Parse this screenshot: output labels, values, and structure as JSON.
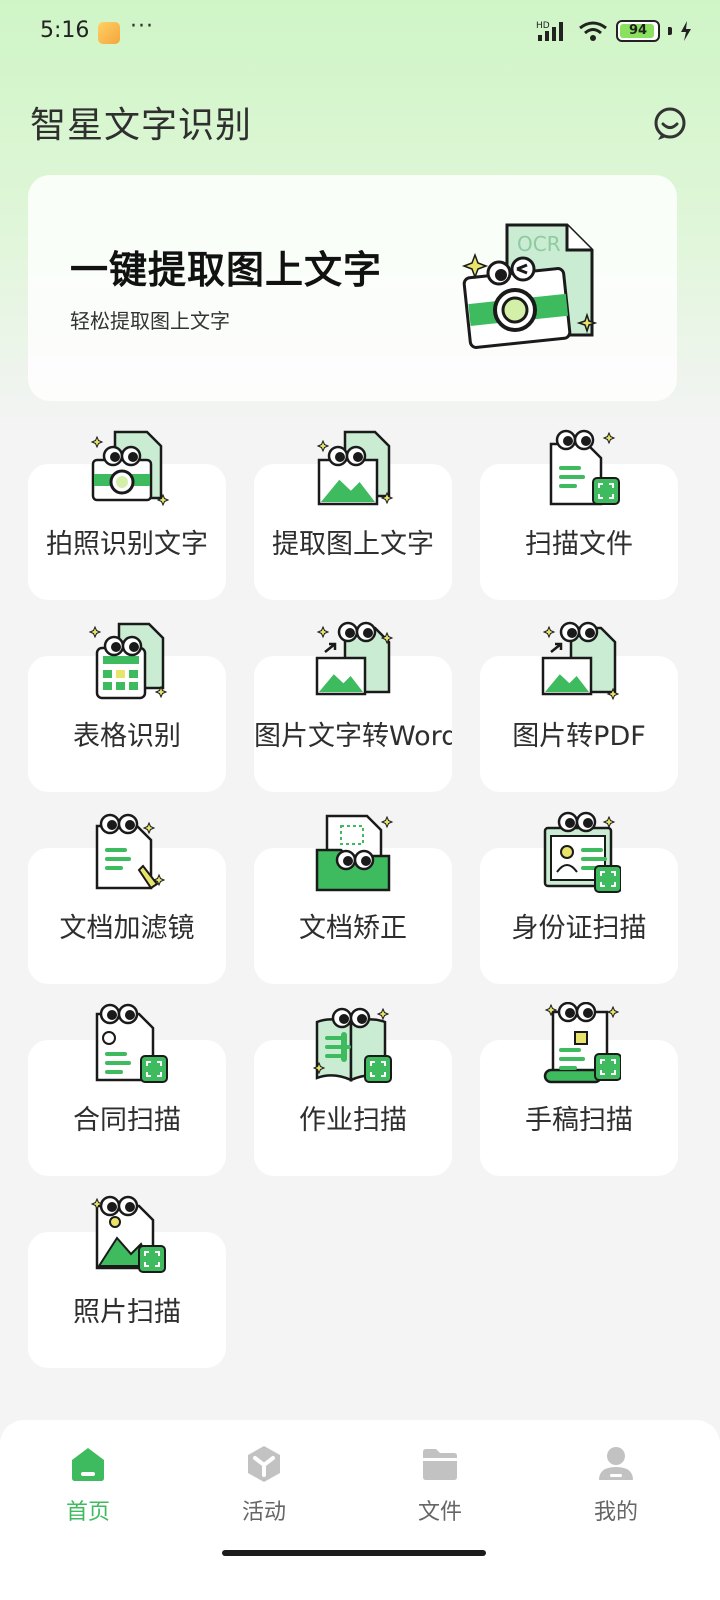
{
  "status": {
    "time": "5:16",
    "more": "···",
    "network": "HD",
    "battery": "94",
    "battery_level": 0.94
  },
  "header": {
    "title": "智星文字识别"
  },
  "banner": {
    "title": "一键提取图上文字",
    "subtitle": "轻松提取图上文字",
    "art_label": "OCR"
  },
  "features": [
    {
      "label": "拍照识别文字",
      "icon": "camera-ocr-icon"
    },
    {
      "label": "提取图上文字",
      "icon": "image-text-icon"
    },
    {
      "label": "扫描文件",
      "icon": "scan-file-icon"
    },
    {
      "label": "表格识别",
      "icon": "table-icon"
    },
    {
      "label": "图片文字转Word",
      "icon": "image-to-word-icon"
    },
    {
      "label": "图片转PDF",
      "icon": "image-to-pdf-icon"
    },
    {
      "label": "文档加滤镜",
      "icon": "doc-filter-icon"
    },
    {
      "label": "文档矫正",
      "icon": "doc-correct-icon"
    },
    {
      "label": "身份证扫描",
      "icon": "id-card-icon"
    },
    {
      "label": "合同扫描",
      "icon": "contract-icon"
    },
    {
      "label": "作业扫描",
      "icon": "homework-icon"
    },
    {
      "label": "手稿扫描",
      "icon": "manuscript-icon"
    },
    {
      "label": "照片扫描",
      "icon": "photo-icon"
    }
  ],
  "nav": [
    {
      "label": "首页",
      "icon": "home-icon",
      "active": true
    },
    {
      "label": "活动",
      "icon": "activity-icon",
      "active": false
    },
    {
      "label": "文件",
      "icon": "folder-icon",
      "active": false
    },
    {
      "label": "我的",
      "icon": "profile-icon",
      "active": false
    }
  ],
  "colors": {
    "accent": "#3ebb5e",
    "light_green": "#c9ecd3",
    "nav_inactive": "#c2c2c2"
  }
}
